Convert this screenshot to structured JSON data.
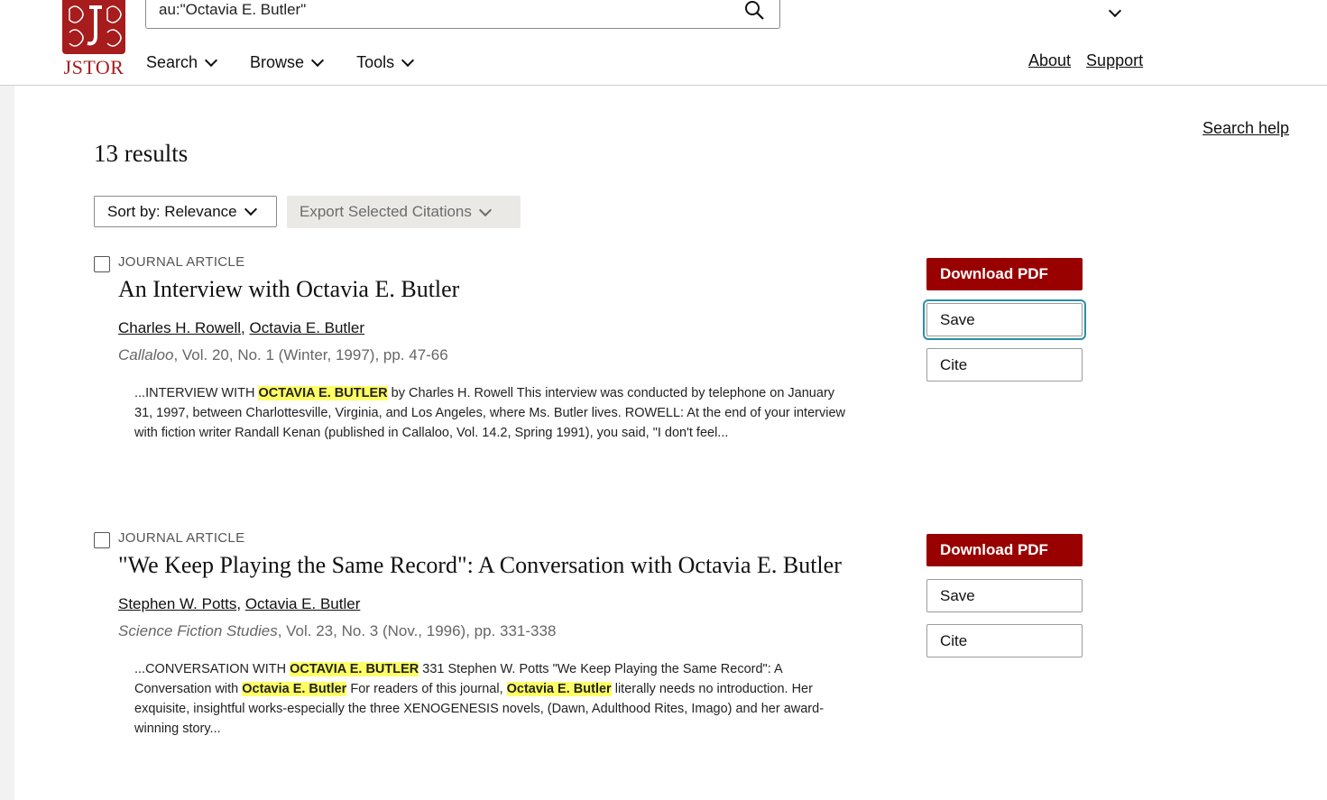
{
  "header": {
    "logo_text": "JSTOR",
    "search_value": "au:\"Octavia E. Butler\"",
    "nav": [
      {
        "label": "Search"
      },
      {
        "label": "Browse"
      },
      {
        "label": "Tools"
      }
    ],
    "links": {
      "about": "About",
      "support": "Support"
    }
  },
  "main": {
    "search_help": "Search help",
    "results_count": "13 results",
    "sort_label": "Sort by: Relevance",
    "export_label": "Export Selected Citations"
  },
  "results": [
    {
      "type": "JOURNAL ARTICLE",
      "title": "An Interview with Octavia E. Butler",
      "authors": [
        "Charles H. Rowell",
        "Octavia E. Butler"
      ],
      "journal": "Callaloo",
      "details": ", Vol. 20, No. 1 (Winter, 1997), pp. 47-66",
      "snippet": {
        "p1": "...INTERVIEW WITH ",
        "h1": "OCTAVIA E. BUTLER",
        "p2": " by Charles H. Rowell This interview was conducted by telephone on January 31, 1997, between Charlottesville, Virginia, and Los Angeles, where Ms. Butler lives. ROWELL: At the end of your interview with fiction writer Randall Kenan (published in Callaloo, Vol. 14.2, Spring 1991), you said, \"I don't feel..."
      },
      "actions": {
        "pdf": "Download PDF",
        "save": "Save",
        "cite": "Cite"
      }
    },
    {
      "type": "JOURNAL ARTICLE",
      "title": "\"We Keep Playing the Same Record\": A Conversation with Octavia E. Butler",
      "authors": [
        "Stephen W. Potts",
        "Octavia E. Butler"
      ],
      "journal": "Science Fiction Studies",
      "details": ", Vol. 23, No. 3 (Nov., 1996), pp. 331-338",
      "snippet": {
        "p1": "...CONVERSATION WITH ",
        "h1": "OCTAVIA E. BUTLER",
        "p2": " 331 Stephen W. Potts \"We Keep Playing the Same Record\": A Conversation with ",
        "h2": "Octavia E. Butler",
        "p3": " For readers of this journal, ",
        "h3": "Octavia E. Butler",
        "p4": " literally needs no introduction. Her exquisite, insightful works-especially the three XENOGENESIS novels, (Dawn, Adulthood Rites, Imago) and her award-winning story..."
      },
      "actions": {
        "pdf": "Download PDF",
        "save": "Save",
        "cite": "Cite"
      }
    }
  ],
  "colors": {
    "brand": "#990000",
    "highlight": "#ffff66",
    "focus": "#2b8fa6"
  },
  "icons": [
    "jstor-logo-icon",
    "search-icon",
    "chevron-down-icon"
  ]
}
